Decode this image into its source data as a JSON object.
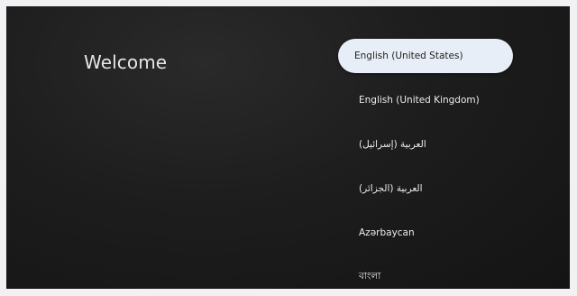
{
  "welcome": {
    "title": "Welcome"
  },
  "languages": {
    "items": [
      {
        "label": "English (United States)",
        "selected": true
      },
      {
        "label": "English (United Kingdom)"
      },
      {
        "label": "العربية (إسرائيل)"
      },
      {
        "label": "العربية (الجزائر)"
      },
      {
        "label": "Azərbaycan"
      },
      {
        "label": "বাংলা"
      }
    ]
  }
}
